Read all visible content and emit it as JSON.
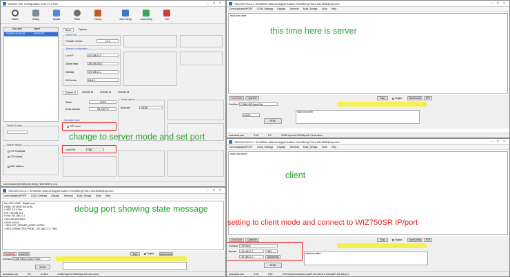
{
  "colors": {
    "annotation_green": "#29a82e",
    "annotation_red": "#e8201b",
    "sscom_bar_red": "#c33a3a",
    "highlight_yellow": "#f3f050"
  },
  "annotations": {
    "server": "this time here is server",
    "client": "client",
    "change_mode": "change to server mode and set port",
    "debug_port": "debug port showing state message",
    "client_mode": "setting to client mode and connect to WIZ750SR IP/port"
  },
  "config_tool": {
    "title": "WIZnet S2E Configuration Tool V1.3 Dev",
    "toolbar": [
      "Search",
      "Setting",
      "Upload",
      "Reset",
      "Factory",
      "Save Config",
      "Load Config",
      "Exit"
    ],
    "device_list": {
      "headers": [
        "Mac addr",
        "Name"
      ],
      "rows": [
        [
          "00:08:DC:54:16:9A",
          "WIZ750SR"
        ]
      ]
    },
    "tabs": [
      "Basic",
      "Options"
    ],
    "device_info": {
      "title": "Device info",
      "fw_label": "Firmware version",
      "fw_value": "1.2.4"
    },
    "network": {
      "title": "Network configuration",
      "local_ip": "Local IP",
      "local_ip_val": "192.168.11.2",
      "subnet": "Subnet mask",
      "subnet_val": "255.255.255.0",
      "gateway": "Gateway",
      "gateway_val": "192.168.11.1",
      "dns": "DNS server",
      "dns_val": "8.8.8.8"
    },
    "channel_tabs": [
      "Channel #1",
      "Channel #2",
      "Channel #3",
      "Channel #4"
    ],
    "status": {
      "label": "Status",
      "value": "OPEN",
      "serial_label": "Serial interface",
      "serial_value": "RS-232/TTL"
    },
    "op_mode": {
      "title": "Operation mode",
      "tcp_server": "TCP server"
    },
    "local_port_label": "Local Port",
    "local_port_value": "7563",
    "serial_options": {
      "title": "Serial options",
      "baud_label": "Baud rate",
      "baud_value": "115200"
    },
    "search_id_label": "Search ID code",
    "search_method": {
      "title": "Search method",
      "tcp_bcast": "TCP broadcast",
      "tcp_unicast": "TCP unicast",
      "mac_address": "MAC address"
    },
    "statusbar": "Current device [00:08:DC:54:16:9A] - WIZ750SR (1.2.4)"
  },
  "sscom_server": {
    "title": "SSCOM V5.13.1 Serial/Net data debugger,Author:Xi'anMengl?Intro,2618058@qq.com",
    "menu": [
      "CommunicationPORT",
      "COM_Settings",
      "Display",
      "Terminal",
      "Multi_Strings",
      "Tools",
      "Help"
    ],
    "text_line": "read from client",
    "clear": "ClearData",
    "open": "OpenFile",
    "stop": "Stop",
    "english": "English",
    "save": "SaveConfig",
    "ext": "EXT",
    "comnum_label": "ComNum",
    "comnum_value": "COM6 USB Serial Port",
    "port": "115200",
    "send": "SEND",
    "send_text": "read from server",
    "status": [
      "www.daxia.com",
      "S:18",
      "R:0",
      "COM6 Opened 115200bps,8,1,None,None"
    ]
  },
  "sscom_client": {
    "title": "SSCOM V5.13.1 Serial/Net data debugger,Author:Xi'anMengl?Intro,2618058@qq.com",
    "menu": [
      "CommunicationPORT",
      "COM_Settings",
      "Display",
      "Terminal",
      "Multi_Strings",
      "Tools",
      "Help"
    ],
    "text_line": "read from server",
    "clear": "ClearData",
    "open": "OpenFile",
    "stop": "Stop",
    "english": "English",
    "save": "SaveConfig",
    "ext": "EXT",
    "comnum_label": "ComNum",
    "comnum_value": "TCPClient",
    "remote_label": "Remote",
    "remote_value": "192.168.11.2",
    "local_value": "192.168.11.3",
    "port_value": "7563",
    "disconnect": "Disconnect",
    "send": "SEND",
    "send_text": "read from client",
    "status": [
      "www.daxia.com",
      "S:18",
      "R:18",
      "TCPClient(Connected) LocalIP:192.168.11.3 RemoteIP:192.168.11.2"
    ]
  },
  "sscom_debug": {
    "title": "SSCOM V5.13.1 Serial/Net data debugger,Author:Xi'anMengl?Intro,2618058@qq.com",
    "menu": [
      "CommunicationPORT",
      "COM_Settings",
      "Display",
      "Terminal",
      "Multi_Strings",
      "Tools",
      "Help"
    ],
    "lines": [
      "Dev-IO/1.1/S2E - Digital Input",
      "",
      "# MAC: 00:08:DC:54:16:9A",
      "# VER: 1.2.4 Dev",
      "# IP: 192.168.11.2",
      "# GW: 192.168.11.1",
      "# SN: 255.255.255.0",
      "# DNS: 8.8.8.8",
      "",
      "> SEG:TCP_SERVER_MODE:LISTEN",
      "> SEG:CONNECTED FROM - 192.168.11.3 : 7563"
    ],
    "clear": "ClearData",
    "open": "OpenFile",
    "stop": "Stop",
    "english": "English",
    "save": "SaveConfig",
    "comnum_label": "ComNum",
    "comnum_value": "COM8 Silicon Labs CP210x",
    "send": "SEND",
    "status": [
      "www.daxia.com",
      "S:0",
      "R:2254",
      "COM8 Opened 115200bps,8,1,None,None"
    ]
  }
}
